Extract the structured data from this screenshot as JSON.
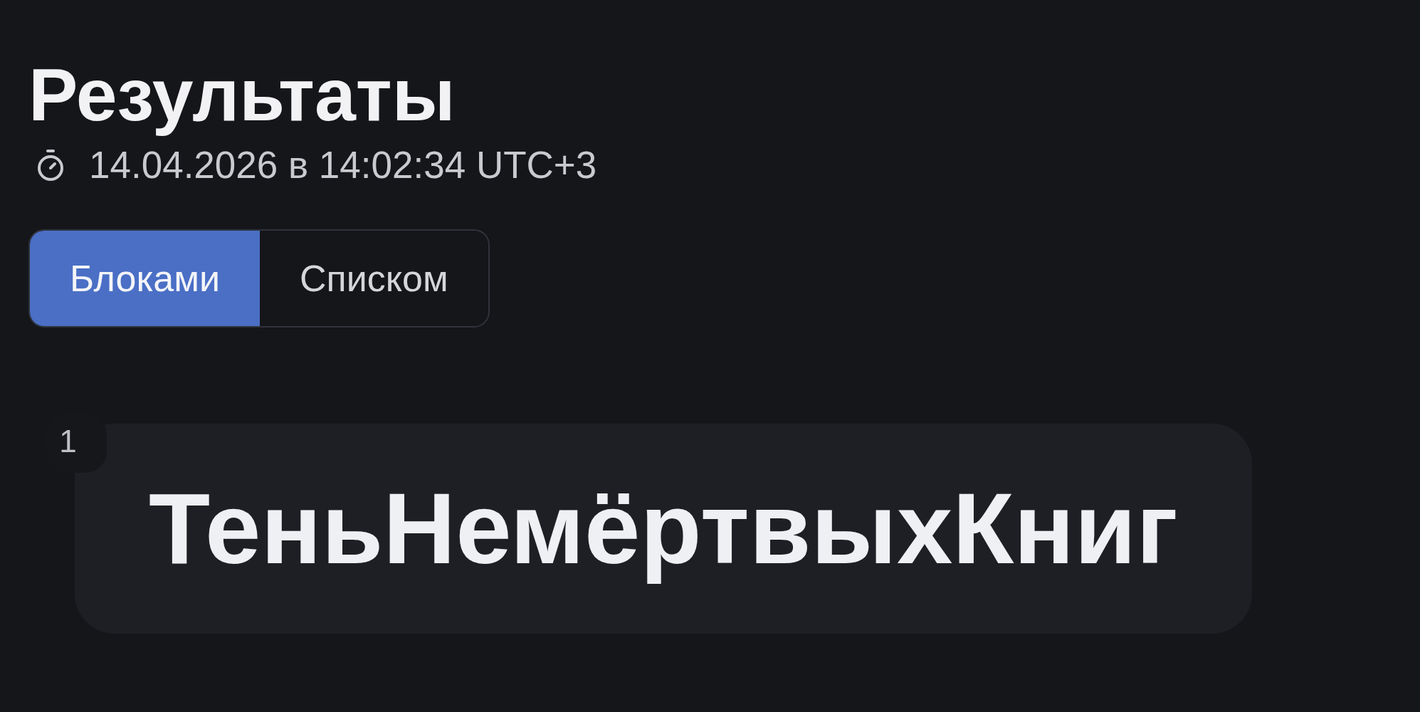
{
  "header": {
    "title": "Результаты",
    "timestamp": "14.04.2026 в 14:02:34 UTC+3"
  },
  "view_tabs": [
    {
      "label": "Блоками",
      "selected": true
    },
    {
      "label": "Списком",
      "selected": false
    }
  ],
  "results": [
    {
      "number": "1",
      "text": "ТеньНемёртвыхКниг"
    }
  ]
}
